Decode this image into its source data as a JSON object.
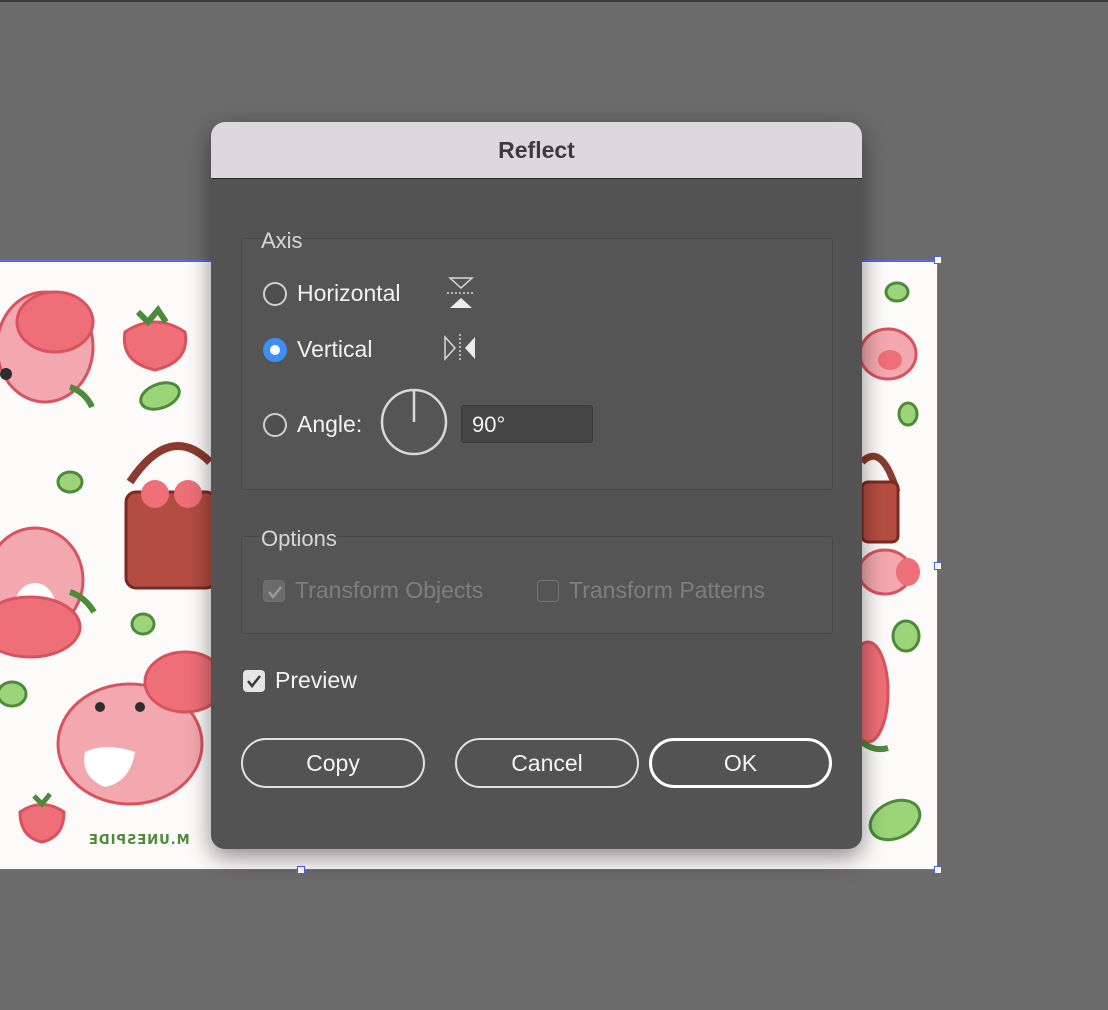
{
  "dialog": {
    "title": "Reflect",
    "axis": {
      "label": "Axis",
      "horizontal": "Horizontal",
      "vertical": "Vertical",
      "angle": "Angle:",
      "angle_value": "90°",
      "selected": "vertical"
    },
    "options": {
      "label": "Options",
      "transform_objects": "Transform Objects",
      "transform_patterns": "Transform Patterns"
    },
    "preview": {
      "label": "Preview",
      "checked": true
    },
    "buttons": {
      "copy": "Copy",
      "cancel": "Cancel",
      "ok": "OK"
    }
  },
  "artwork": {
    "signature_text": "M.UNESPIDE"
  },
  "colors": {
    "accent": "#3d8ff5",
    "selection": "#5a6cf0",
    "dialog_bg": "#535353",
    "canvas_bg": "#6b6b6b"
  },
  "icons": {
    "flip_horizontal": "flip-horizontal-icon",
    "flip_vertical": "flip-vertical-icon",
    "angle_dial": "angle-dial-icon"
  }
}
